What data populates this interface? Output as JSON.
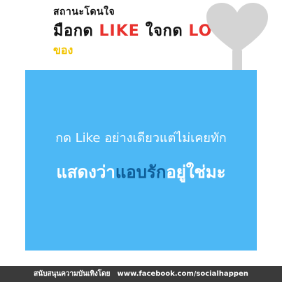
{
  "header": {
    "line1": "สถานะโดนใจ",
    "line2_part1": "มือกด ",
    "line2_like": "LIKE",
    "line2_part2": " ใจกด ",
    "line2_love": "LOVE",
    "line3": "ของ"
  },
  "panel": {
    "line1": "กด Like อย่างเดียวแต่ไม่เคยทัก",
    "line2_part1": "แสดงว่า",
    "line2_highlight": "แอบรัก",
    "line2_part2": "อยู่ใช่มะ"
  },
  "footer": {
    "sponsor": "สนับสนุนความบันเทิงโดย",
    "url": "www.facebook.com/socialhappen"
  },
  "colors": {
    "panel": "#4db8f5",
    "highlight": "#0f5e99",
    "red_text": "#e8322e",
    "yellow_text": "#f2c400",
    "heart": "#d4d4d4",
    "footer": "#3a3a3a"
  }
}
